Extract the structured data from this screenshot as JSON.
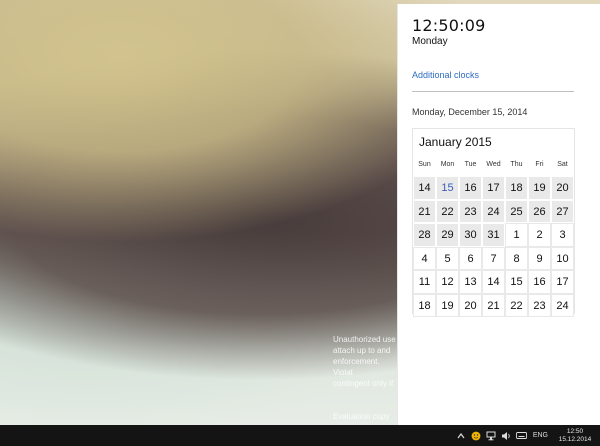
{
  "desktop": {
    "watermark_lines": [
      "Unauthorized use",
      "attach up to and",
      "enforcement. Violat",
      "contingent only if"
    ],
    "watermark_bottom": "Evaluation copy"
  },
  "flyout": {
    "time": "12:50:09",
    "day": "Monday",
    "additional_clocks": "Additional clocks",
    "full_date": "Monday, December 15, 2014"
  },
  "calendar": {
    "month_title": "January 2015",
    "weekdays": [
      "Sun",
      "Mon",
      "Tue",
      "Wed",
      "Thu",
      "Fri",
      "Sat"
    ],
    "days": [
      [
        "14",
        "15",
        "16",
        "17",
        "18",
        "19",
        "20"
      ],
      [
        "21",
        "22",
        "23",
        "24",
        "25",
        "26",
        "27"
      ],
      [
        "28",
        "29",
        "30",
        "31",
        "1",
        "2",
        "3"
      ],
      [
        "4",
        "5",
        "6",
        "7",
        "8",
        "9",
        "10"
      ],
      [
        "11",
        "12",
        "13",
        "14",
        "15",
        "16",
        "17"
      ],
      [
        "18",
        "19",
        "20",
        "21",
        "22",
        "23",
        "24"
      ]
    ],
    "today_label": "15"
  },
  "taskbar": {
    "language": "ENG",
    "clock_time": "12:50",
    "clock_date": "15.12.2014",
    "tray_icons": [
      "chevron-up-icon",
      "smiley-icon",
      "network-icon",
      "speaker-icon",
      "keyboard-icon"
    ]
  },
  "colors": {
    "link": "#2f6cc0",
    "today": "#3a5bb8",
    "taskbar": "#141414"
  }
}
